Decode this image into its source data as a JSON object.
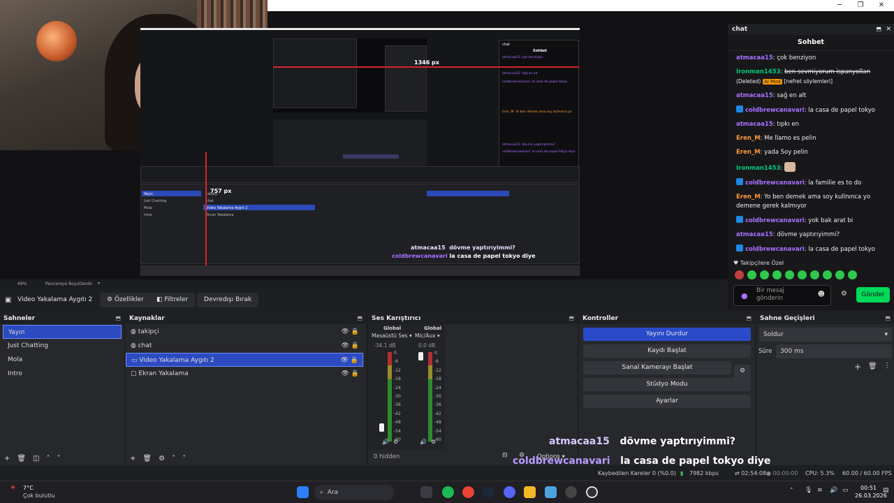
{
  "window": {
    "min": "─",
    "max": "❐",
    "close": "✕"
  },
  "zoom": {
    "percent": "49%",
    "fit": "Pencereye Boyutlandır"
  },
  "toolbar": {
    "source": "Video Yakalama Aygıtı 2",
    "properties": "Özellikler",
    "filters": "Filtreler",
    "deactivate": "Devredışı Bırak"
  },
  "scenes": {
    "title": "Sahneler",
    "items": [
      "Yayın",
      "Just Chatting",
      "Mola",
      "Intro"
    ]
  },
  "sources": {
    "title": "Kaynaklar",
    "items": [
      "takipçi",
      "chat",
      "Video Yakalama Aygıtı 2",
      "Ekran Yakalama"
    ]
  },
  "mixer": {
    "title": "Ses Karıştırıcı",
    "channels": [
      {
        "scope": "Global",
        "name": "Masaüstü Ses",
        "db": "-34.1 dB",
        "level": 0.12
      },
      {
        "scope": "Global",
        "name": "Mic/Aux",
        "db": "0.0 dB",
        "level": 1.0
      }
    ],
    "ticks": [
      "0",
      "-6",
      "-12",
      "-18",
      "-24",
      "-30",
      "-36",
      "-42",
      "-48",
      "-54",
      "-60"
    ],
    "hidden": "0 hidden"
  },
  "controls": {
    "title": "Kontroller",
    "buttons": [
      "Yayını Durdur",
      "Kaydı Başlat",
      "Sanal Kamerayı Başlat",
      "Stüdyo Modu",
      "Ayarlar"
    ]
  },
  "transitions": {
    "title": "Sahne Geçişleri",
    "type": "Soldur",
    "duration_label": "Süre",
    "duration": "300 ms"
  },
  "chat": {
    "window_title": "chat",
    "title": "Sohbet",
    "messages": [
      {
        "user": "atmacaa15",
        "color": "#a970ff",
        "text": "çok benziyon"
      },
      {
        "user": "Ironman1453",
        "color": "#00c97a",
        "text": "ben sevmiyorum ispanyolları",
        "deleted": "(Deleted)",
        "badge": "AI Mod",
        "note": "[nefret söylemleri]"
      },
      {
        "user": "atmacaa15",
        "color": "#a970ff",
        "text": "sağ en alt"
      },
      {
        "user": "coldbrewcanavari",
        "color": "#a970ff",
        "text": "la casa de papel tokyo",
        "icon": true
      },
      {
        "user": "atmacaa15",
        "color": "#a970ff",
        "text": "tıpkı en"
      },
      {
        "user": "Eren_M",
        "color": "#ff9a3c",
        "text": "Me llamo es pelin"
      },
      {
        "user": "Eren_M",
        "color": "#ff9a3c",
        "text": "yada Soy pelin"
      },
      {
        "user": "Ironman1453",
        "color": "#00c97a",
        "text": "",
        "emote": true
      },
      {
        "user": "coldbrewcanavari",
        "color": "#a970ff",
        "text": "la familie es to do",
        "icon": true
      },
      {
        "user": "Eren_M",
        "color": "#ff9a3c",
        "text": "Yo ben demek ama soy kullnınca yo demene gerek kalmıyor"
      },
      {
        "user": "coldbrewcanavari",
        "color": "#a970ff",
        "text": "yok bak arat bi",
        "icon": true
      },
      {
        "user": "atmacaa15",
        "color": "#a970ff",
        "text": "dövme yaptırıyimmi?"
      },
      {
        "user": "coldbrewcanavari",
        "color": "#a970ff",
        "text": "la casa de papel tokyo diye",
        "icon": true
      }
    ],
    "private": "Takipçilere Özel",
    "input_placeholder": "Bir mesaj gönderin",
    "send": "Gönder"
  },
  "overlay": {
    "line1_user": "atmacaa15",
    "line1_text": "dövme yaptırıyimmi?",
    "line2_user": "coldbrewcanavari",
    "line2_text": "la casa de papel tokyo diye"
  },
  "preview_labels": {
    "px1": "1346 px",
    "px2": "757 px",
    "sohbet": "Sohbet",
    "chat": "chat"
  },
  "mixer_options": "Options",
  "status": {
    "dropped": "Kaybedilen Kareler 0 (%0.0)",
    "kbps": "7982 kbps",
    "live": "02:54:08",
    "rec": "00:00:00",
    "cpu": "CPU: 5.3%",
    "fps": "60.00 / 60.00 FPS"
  },
  "taskbar": {
    "temp": "7°C",
    "weather": "Çok bulutlu",
    "search": "Ara",
    "time": "00:51",
    "date": "26.03.2026"
  }
}
